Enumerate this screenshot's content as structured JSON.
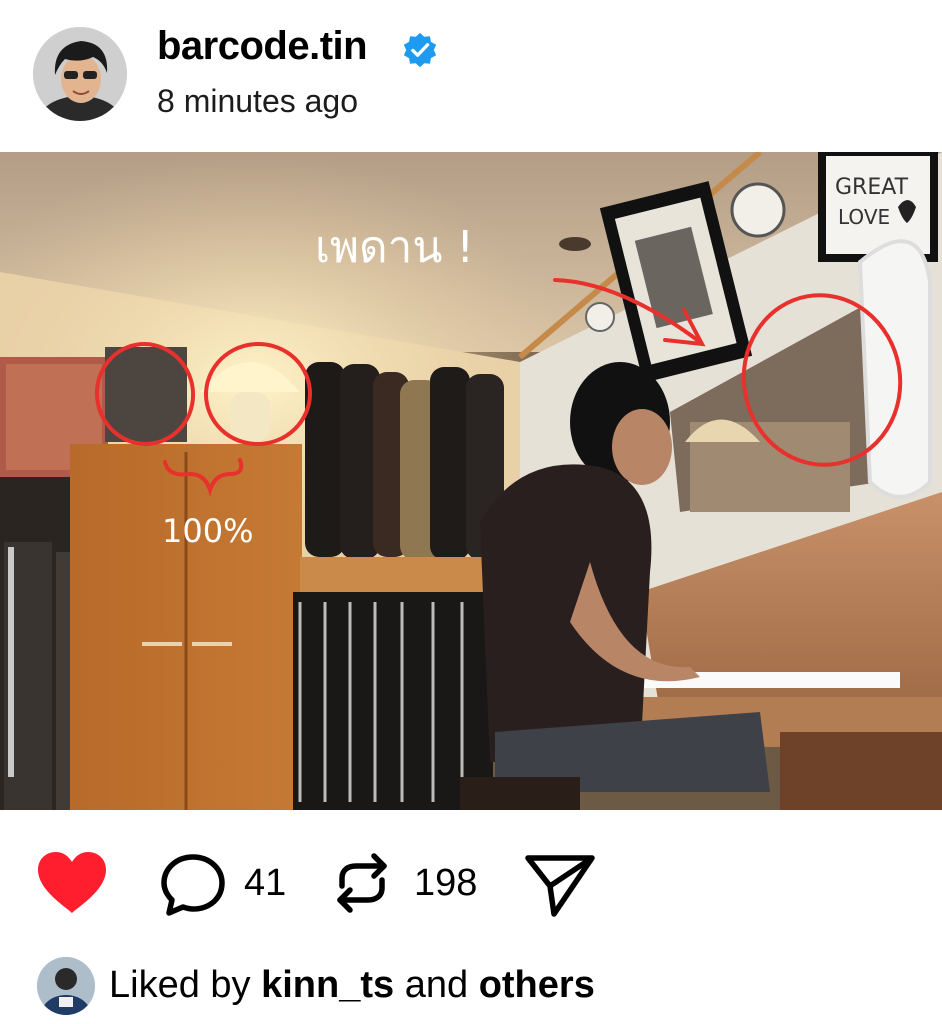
{
  "post": {
    "author": {
      "username": "barcode.tin",
      "verified": true,
      "avatar_icon": "profile-photo",
      "timestamp": "8 minutes ago"
    },
    "image": {
      "handwritten_annotations": [
        "เพดาน !",
        "100%"
      ],
      "annotation_color": "#e8302c",
      "poster_text": "GREAT LOVE"
    },
    "actions": {
      "like_icon": "heart-filled-icon",
      "like_color": "#ff1e2d",
      "comment_icon": "comment-bubble-icon",
      "comment_count": "41",
      "repost_icon": "repost-icon",
      "repost_count": "198",
      "share_icon": "send-icon"
    },
    "liked_by": {
      "prefix": "Liked by",
      "user": "kinn_ts",
      "connector": "and",
      "others": "others"
    }
  }
}
